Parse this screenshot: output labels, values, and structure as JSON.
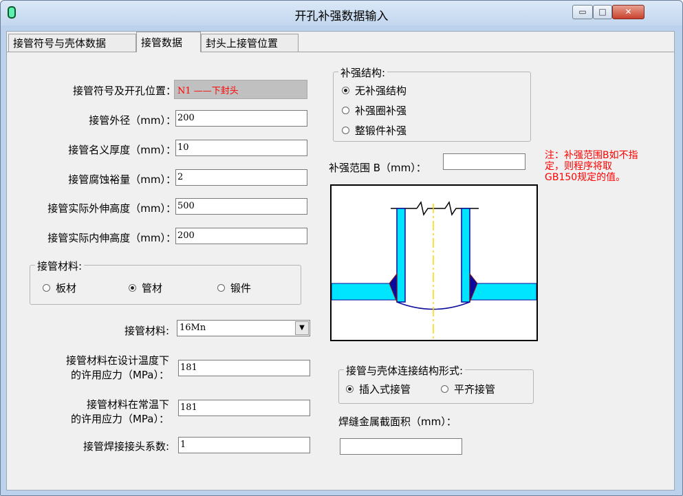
{
  "window": {
    "title": "开孔补强数据输入"
  },
  "title_buttons": {
    "minimize": "▭",
    "maximize": "□",
    "close": "✕"
  },
  "tabs": [
    {
      "label": "接管符号与壳体数据"
    },
    {
      "label": "接管数据"
    },
    {
      "label": "封头上接管位置"
    }
  ],
  "form": {
    "symbol": {
      "label": "接管符号及开孔位置：",
      "value": "N1 ——下封头"
    },
    "od": {
      "label": "接管外径（mm）：",
      "value": "200"
    },
    "thickness": {
      "label": "接管名义厚度（mm）：",
      "value": "10"
    },
    "corrosion": {
      "label": "接管腐蚀裕量（mm）：",
      "value": "2"
    },
    "outer_height": {
      "label": "接管实际外伸高度（mm）：",
      "value": "500"
    },
    "inner_height": {
      "label": "接管实际内伸高度（mm）：",
      "value": "200"
    },
    "material_type": {
      "title": "接管材料:",
      "options": [
        "板材",
        "管材",
        "锻件"
      ],
      "selected": "管材"
    },
    "material": {
      "label": "接管材料:",
      "value": "16Mn"
    },
    "stress_design": {
      "label_line1": "接管材料在设计温度下",
      "label_line2": "的许用应力（MPa）：",
      "value": "181"
    },
    "stress_room": {
      "label_line1": "接管材料在常温下",
      "label_line2": "的许用应力（MPa）：",
      "value": "181"
    },
    "weld_coef": {
      "label": "接管焊接接头系数:",
      "value": "1"
    }
  },
  "reinforcement": {
    "title": "补强结构:",
    "options": [
      "无补强结构",
      "补强圈补强",
      "整锻件补强"
    ],
    "selected": "无补强结构",
    "range_label": "补强范围 B（mm）：",
    "range_value": "",
    "note": "注：补强范围B如不指定，则程序将取GB150规定的值。"
  },
  "connection": {
    "title": "接管与壳体连接结构形式:",
    "options": [
      "插入式接管",
      "平齐接管"
    ],
    "selected": "插入式接管"
  },
  "weld_area": {
    "label": "焊缝金属截面积（mm）：",
    "value": ""
  },
  "colors": {
    "shell": "#00e5ff",
    "pipe": "#00e5ff",
    "centerline": "#ffd400",
    "weld": "#0a0a9c",
    "note": "#ff0000"
  }
}
